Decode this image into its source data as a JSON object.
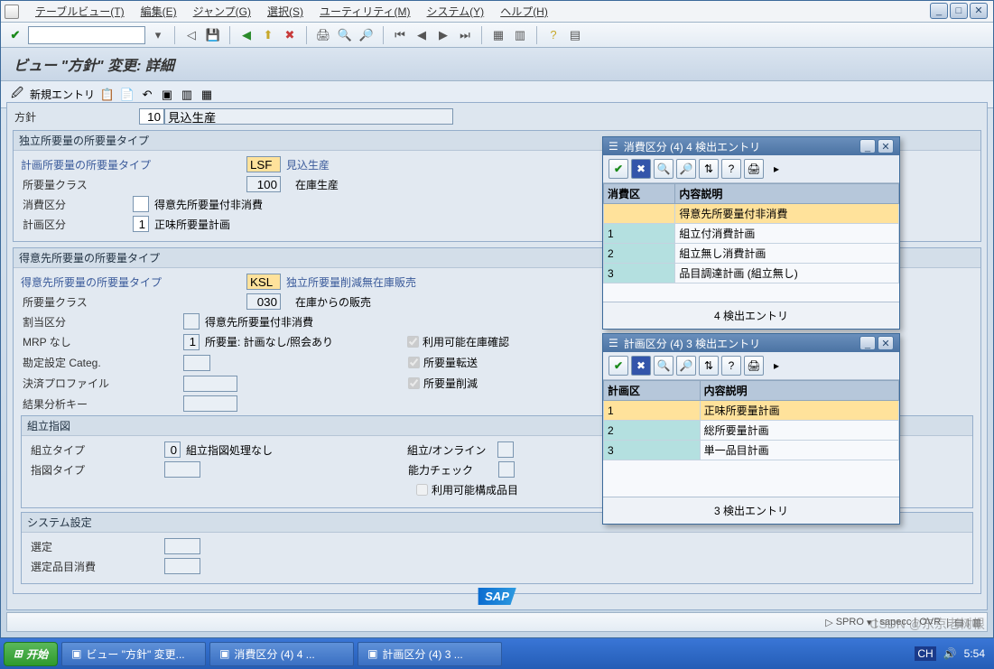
{
  "menu": {
    "tableview": "テーブルビュー(T)",
    "edit": "編集(E)",
    "jump": "ジャンプ(G)",
    "select": "選択(S)",
    "utility": "ユーティリティ(M)",
    "system": "システム(Y)",
    "help": "ヘルプ(H)"
  },
  "page_title": "ビュー \"方針\" 変更: 詳細",
  "apptoolbar": {
    "new_entry": "新規エントリ"
  },
  "header": {
    "policy_label": "方針",
    "policy_code": "10",
    "policy_text": "見込生産"
  },
  "group1": {
    "title": "独立所要量の所要量タイプ",
    "plan_req_label": "計画所要量の所要量タイプ",
    "plan_req_code": "LSF",
    "plan_req_text": "見込生産",
    "req_class_label": "所要量クラス",
    "req_class_code": "100",
    "req_class_text": "在庫生産",
    "consume_div_label": "消費区分",
    "consume_div_text": "得意先所要量付非消費",
    "plan_div_label": "計画区分",
    "plan_div_code": "1",
    "plan_div_text": "正味所要量計画"
  },
  "group2": {
    "title": "得意先所要量の所要量タイプ",
    "cust_req_label": "得意先所要量の所要量タイプ",
    "cust_req_code": "KSL",
    "cust_req_text": "独立所要量削減無在庫販売",
    "req_class_label": "所要量クラス",
    "req_class_code": "030",
    "req_class_text": "在庫からの販売",
    "alloc_label": "割当区分",
    "alloc_text": "得意先所要量付非消費",
    "mrp_label": "MRP なし",
    "mrp_code": "1",
    "mrp_text": "所要量: 計画なし/照会あり",
    "acct_label": "勘定設定 Categ.",
    "settle_label": "決済プロファイル",
    "result_label": "結果分析キー",
    "chk_avail": "利用可能在庫確認",
    "chk_transfer": "所要量転送",
    "chk_reduce": "所要量削減",
    "sub_title": "組立指図",
    "asm_type_label": "組立タイプ",
    "asm_type_code": "0",
    "asm_type_text": "組立指図処理なし",
    "inst_type_label": "指図タイプ",
    "online_label": "組立/オンライン",
    "capacity_label": "能力チェック",
    "chk_config": "利用可能構成品目",
    "sys_title": "システム設定",
    "select_label": "選定",
    "select_item_label": "選定品目消費"
  },
  "popup1": {
    "title": "消費区分 (4)    4 検出エントリ",
    "col1": "消費区",
    "col2": "内容説明",
    "rows": [
      {
        "c1": "",
        "c2": "得意先所要量付非消費"
      },
      {
        "c1": "1",
        "c2": "組立付消費計画"
      },
      {
        "c1": "2",
        "c2": "組立無し消費計画"
      },
      {
        "c1": "3",
        "c2": "品目調達計画 (組立無し)"
      }
    ],
    "footer": "4 検出エントリ"
  },
  "popup2": {
    "title": "計画区分 (4)    3 検出エントリ",
    "col1": "計画区",
    "col2": "内容説明",
    "rows": [
      {
        "c1": "1",
        "c2": "正味所要量計画"
      },
      {
        "c1": "2",
        "c2": "総所要量計画"
      },
      {
        "c1": "3",
        "c2": "単一品目計画"
      }
    ],
    "footer": "3 検出エントリ"
  },
  "status": {
    "s1": "SPRO",
    "s2": "sapecc",
    "s3": "OVR"
  },
  "taskbar": {
    "start": "开始",
    "t1": "ビュー \"方針\" 変更...",
    "t2": "消費区分 (4)    4 ...",
    "t3": "計画区分 (4)    3 ...",
    "time": "5:54"
  },
  "watermark": "CSDN @东京老树根"
}
